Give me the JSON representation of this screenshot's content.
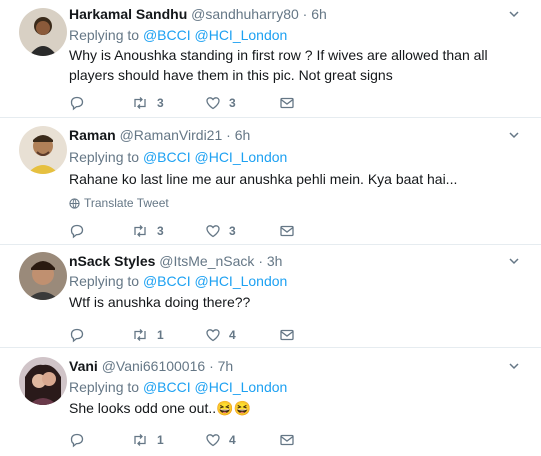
{
  "tweets": [
    {
      "name": "Harkamal Sandhu",
      "handle": "@sandhuharry80",
      "dot": "·",
      "time": "6h",
      "replying_prefix": "Replying to",
      "mentions": [
        "@BCCI",
        "@HCI_London"
      ],
      "text": "Why is Anoushka standing in first row ? If wives are allowed than all players should have them in this pic. Not great signs",
      "retweets": "3",
      "likes": "3",
      "avatar_color": "#5a4a3a"
    },
    {
      "name": "Raman",
      "handle": "@RamanVirdi21",
      "dot": "·",
      "time": "6h",
      "replying_prefix": "Replying to",
      "mentions": [
        "@BCCI",
        "@HCI_London"
      ],
      "text": "Rahane ko last line me aur anushka pehli mein. Kya baat hai...",
      "translate": "Translate Tweet",
      "retweets": "3",
      "likes": "3",
      "avatar_color": "#c9a77a"
    },
    {
      "name": "nSack Styles",
      "handle": "@ItsMe_nSack",
      "dot": "·",
      "time": "3h",
      "replying_prefix": "Replying to",
      "mentions": [
        "@BCCI",
        "@HCI_London"
      ],
      "text": "Wtf is anushka doing there??",
      "retweets": "1",
      "likes": "4",
      "avatar_color": "#7a6a5a"
    },
    {
      "name": "Vani",
      "handle": "@Vani66100016",
      "dot": "·",
      "time": "7h",
      "replying_prefix": "Replying to",
      "mentions": [
        "@BCCI",
        "@HCI_London"
      ],
      "text": "She looks odd one out..",
      "emoji": "😆😆",
      "retweets": "1",
      "likes": "4",
      "avatar_color": "#8a6a7a"
    }
  ],
  "colors": {
    "link": "#1da1f2",
    "secondary": "#657786",
    "divider": "#e6ecf0"
  }
}
